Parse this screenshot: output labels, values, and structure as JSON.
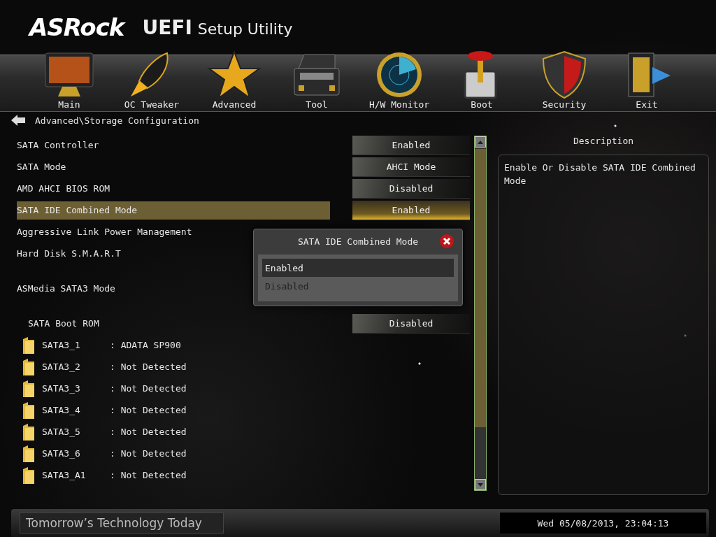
{
  "header": {
    "logo": "ASRock",
    "title_bold": "UEFI",
    "title": "Setup Utility"
  },
  "nav": [
    {
      "label": "Main"
    },
    {
      "label": "OC Tweaker"
    },
    {
      "label": "Advanced"
    },
    {
      "label": "Tool"
    },
    {
      "label": "H/W Monitor"
    },
    {
      "label": "Boot"
    },
    {
      "label": "Security"
    },
    {
      "label": "Exit"
    }
  ],
  "breadcrumb": "Advanced\\Storage Configuration",
  "rows": [
    {
      "kind": "setting",
      "label": "SATA Controller",
      "value": "Enabled",
      "selected": false
    },
    {
      "kind": "setting",
      "label": "SATA Mode",
      "value": "AHCI Mode",
      "selected": false
    },
    {
      "kind": "setting",
      "label": "AMD AHCI BIOS ROM",
      "value": "Disabled",
      "selected": false
    },
    {
      "kind": "setting",
      "label": "SATA IDE Combined Mode",
      "value": "Enabled",
      "selected": true
    },
    {
      "kind": "setting",
      "label": "Aggressive Link Power Management",
      "selected": false
    },
    {
      "kind": "setting",
      "label": "Hard Disk S.M.A.R.T",
      "selected": false
    },
    {
      "kind": "section",
      "label": "ASMedia SATA3 Mode",
      "selected": false
    },
    {
      "kind": "subsetting",
      "label": "SATA Boot ROM",
      "value": "Disabled",
      "selected": false
    },
    {
      "kind": "drive",
      "label": "SATA3_1",
      "value": ": ADATA SP900",
      "selected": false
    },
    {
      "kind": "drive",
      "label": "SATA3_2",
      "value": ": Not Detected",
      "selected": false
    },
    {
      "kind": "drive",
      "label": "SATA3_3",
      "value": ": Not Detected",
      "selected": false
    },
    {
      "kind": "drive",
      "label": "SATA3_4",
      "value": ": Not Detected",
      "selected": false
    },
    {
      "kind": "drive",
      "label": "SATA3_5",
      "value": ": Not Detected",
      "selected": false
    },
    {
      "kind": "drive",
      "label": "SATA3_6",
      "value": ": Not Detected",
      "selected": false
    },
    {
      "kind": "drive",
      "label": "SATA3_A1",
      "value": ": Not Detected",
      "selected": false
    }
  ],
  "popup": {
    "title": "SATA IDE Combined Mode",
    "options": [
      {
        "label": "Enabled",
        "selected": true
      },
      {
        "label": "Disabled",
        "selected": false
      }
    ]
  },
  "description": {
    "heading": "Description",
    "text": "Enable Or Disable SATA IDE Combined Mode"
  },
  "status_bar": {
    "slogan": "Tomorrow’s Technology Today",
    "datetime": "Wed 05/08/2013, 23:04:13"
  }
}
